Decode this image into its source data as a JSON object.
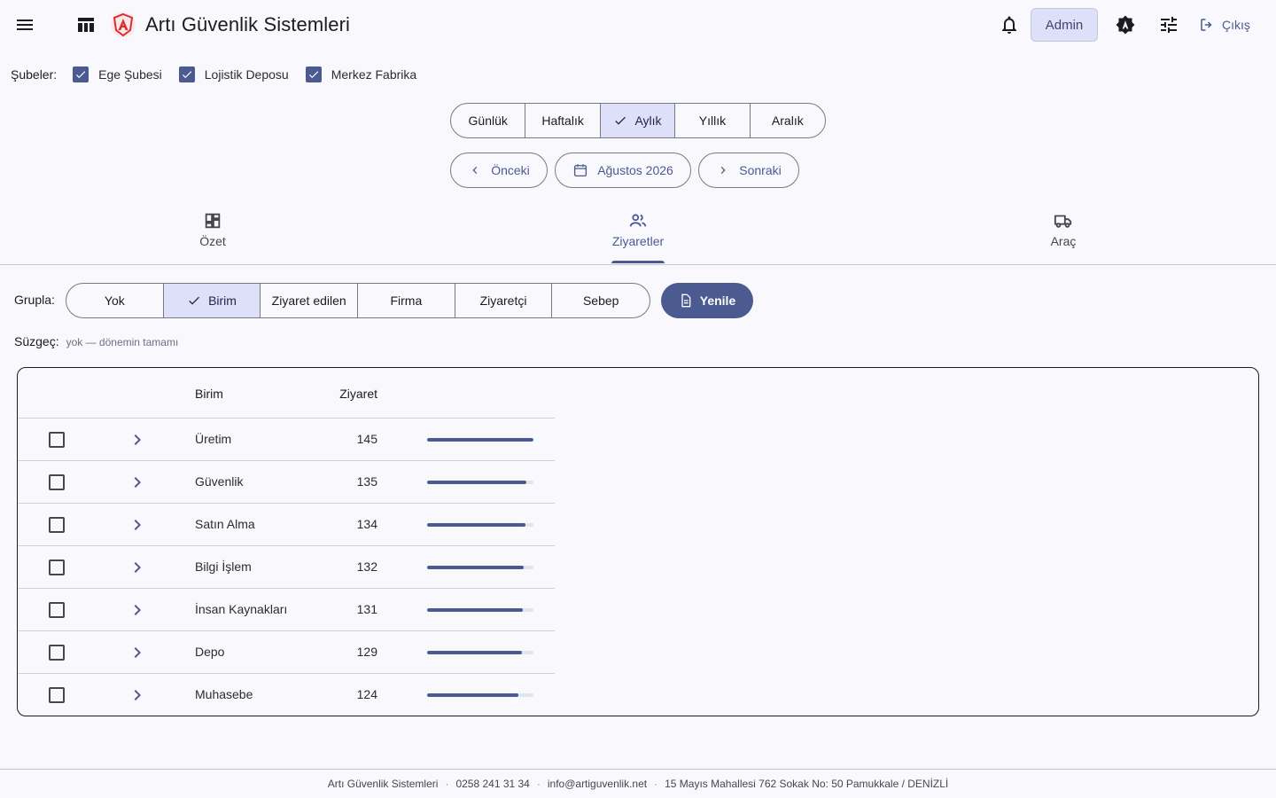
{
  "header": {
    "title": "Artı Güvenlik Sistemleri",
    "admin_label": "Admin",
    "logout_label": "Çıkış",
    "icons": [
      "menu-icon",
      "dashboard-icon",
      "logo-icon",
      "bell-icon",
      "brightness-auto-icon",
      "tune-icon",
      "logout-icon"
    ]
  },
  "branches": {
    "label": "Şubeler:",
    "items": [
      {
        "label": "Ege Şubesi",
        "checked": true
      },
      {
        "label": "Lojistik Deposu",
        "checked": true
      },
      {
        "label": "Merkez Fabrika",
        "checked": true
      }
    ]
  },
  "period": {
    "options": [
      "Günlük",
      "Haftalık",
      "Aylık",
      "Yıllık",
      "Aralık"
    ],
    "selected": "Aylık",
    "prev_label": "Önceki",
    "current_label": "Ağustos 2026",
    "next_label": "Sonraki"
  },
  "tabs": [
    {
      "label": "Özet",
      "icon": "dashboard-outline-icon"
    },
    {
      "label": "Ziyaretler",
      "icon": "people-icon",
      "active": true
    },
    {
      "label": "Araç",
      "icon": "truck-icon"
    }
  ],
  "group": {
    "label": "Grupla:",
    "options": [
      "Yok",
      "Birim",
      "Ziyaret edilen",
      "Firma",
      "Ziyaretçi",
      "Sebep"
    ],
    "selected": "Birim",
    "refresh_label": "Yenile"
  },
  "filter": {
    "label": "Süzgeç:",
    "value": "yok — dönemin tamamı"
  },
  "table": {
    "columns": [
      "Birim",
      "Ziyaret"
    ],
    "rows": [
      {
        "name": "Üretim",
        "count": "145",
        "share": 1.0
      },
      {
        "name": "Güvenlik",
        "count": "135",
        "share": 0.931
      },
      {
        "name": "Satın Alma",
        "count": "134",
        "share": 0.924
      },
      {
        "name": "Bilgi İşlem",
        "count": "132",
        "share": 0.91
      },
      {
        "name": "İnsan Kaynakları",
        "count": "131",
        "share": 0.903
      },
      {
        "name": "Depo",
        "count": "129",
        "share": 0.89
      },
      {
        "name": "Muhasebe",
        "count": "124",
        "share": 0.855
      }
    ]
  },
  "footer": {
    "company": "Artı Güvenlik Sistemleri",
    "phone": "0258 241 31 34",
    "email": "info@artiguvenlik.net",
    "address": "15 Mayıs Mahallesi 762 Sokak No: 50 Pamukkale / DENİZLİ"
  },
  "colors": {
    "primary": "#4c5a92",
    "selected_bg": "#dee0fa",
    "background": "#f8f8fd",
    "logo_red": "#dd2c2c"
  }
}
